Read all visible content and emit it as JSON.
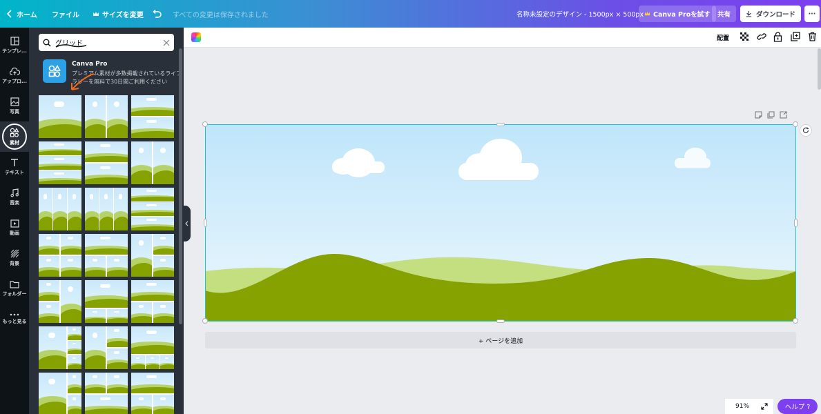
{
  "topbar": {
    "home_label": "ホーム",
    "file_label": "ファイル",
    "resize_label": "サイズを変更",
    "saved_status": "すべての変更は保存されました",
    "document_title": "名称未設定のデザイン - 1500px × 500px",
    "pro_trial_label": "Canva Proを試す",
    "share_label": "共有",
    "download_label": "ダウンロード",
    "more_label": "···"
  },
  "rail": {
    "items": [
      {
        "label": "テンプレ...",
        "icon": "template-icon"
      },
      {
        "label": "アップロ...",
        "icon": "upload-icon"
      },
      {
        "label": "写真",
        "icon": "photo-icon"
      },
      {
        "label": "素材",
        "icon": "elements-icon"
      },
      {
        "label": "テキスト",
        "icon": "text-icon"
      },
      {
        "label": "音楽",
        "icon": "music-icon"
      },
      {
        "label": "動画",
        "icon": "video-icon"
      },
      {
        "label": "背景",
        "icon": "background-icon"
      },
      {
        "label": "フォルダー",
        "icon": "folder-icon"
      },
      {
        "label": "もっと見る",
        "icon": "more-icon"
      }
    ]
  },
  "panel": {
    "search_value": "グリッド",
    "pro_card": {
      "title": "Canva Pro",
      "description": "プレミアム素材が多数掲載されているライブラリーを無料で30日間ご利用ください"
    }
  },
  "canvas": {
    "arrange_label": "配置",
    "add_page_label": "+ ページを追加",
    "zoom_label": "91%",
    "help_label": "ヘルプ ?"
  },
  "colors": {
    "accent": "#7d3ff0",
    "selection": "#19c5d2",
    "hill_dark": "#86a200",
    "hill_light": "#c4df7f",
    "sky": "#bfe5fa"
  }
}
